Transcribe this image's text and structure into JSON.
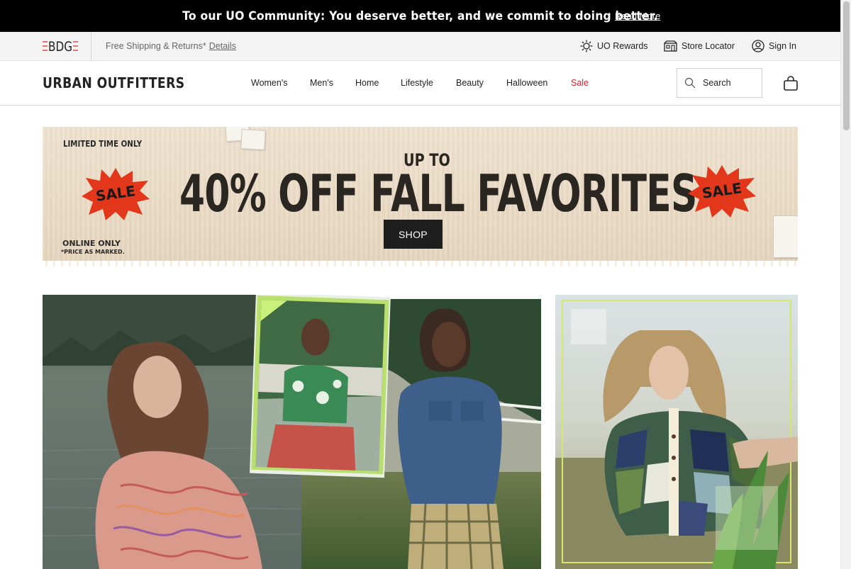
{
  "announcement": {
    "text": "To our UO Community: You deserve better, and we commit to doing better.",
    "link": "Read More"
  },
  "utility_bar": {
    "logo_text": "BDG",
    "shipping_text": "Free Shipping & Returns*",
    "shipping_link": "Details",
    "rewards": "UO Rewards",
    "store_locator": "Store Locator",
    "sign_in": "Sign In"
  },
  "header": {
    "brand": "URBAN OUTFITTERS",
    "nav": [
      "Women's",
      "Men's",
      "Home",
      "Lifestyle",
      "Beauty",
      "Halloween",
      "Sale"
    ],
    "search_placeholder": "Search"
  },
  "hero": {
    "limited": "LIMITED TIME ONLY",
    "up_to": "UP TO",
    "headline": "40% OFF FALL FAVORITES",
    "sale_badge": "SALE",
    "online_only": "ONLINE ONLY",
    "price_note": "*PRICE AS MARKED.",
    "cta": "SHOP"
  },
  "colors": {
    "sale_red": "#d4202a",
    "starburst_red": "#e2371b",
    "announcement_bg": "#000000"
  }
}
